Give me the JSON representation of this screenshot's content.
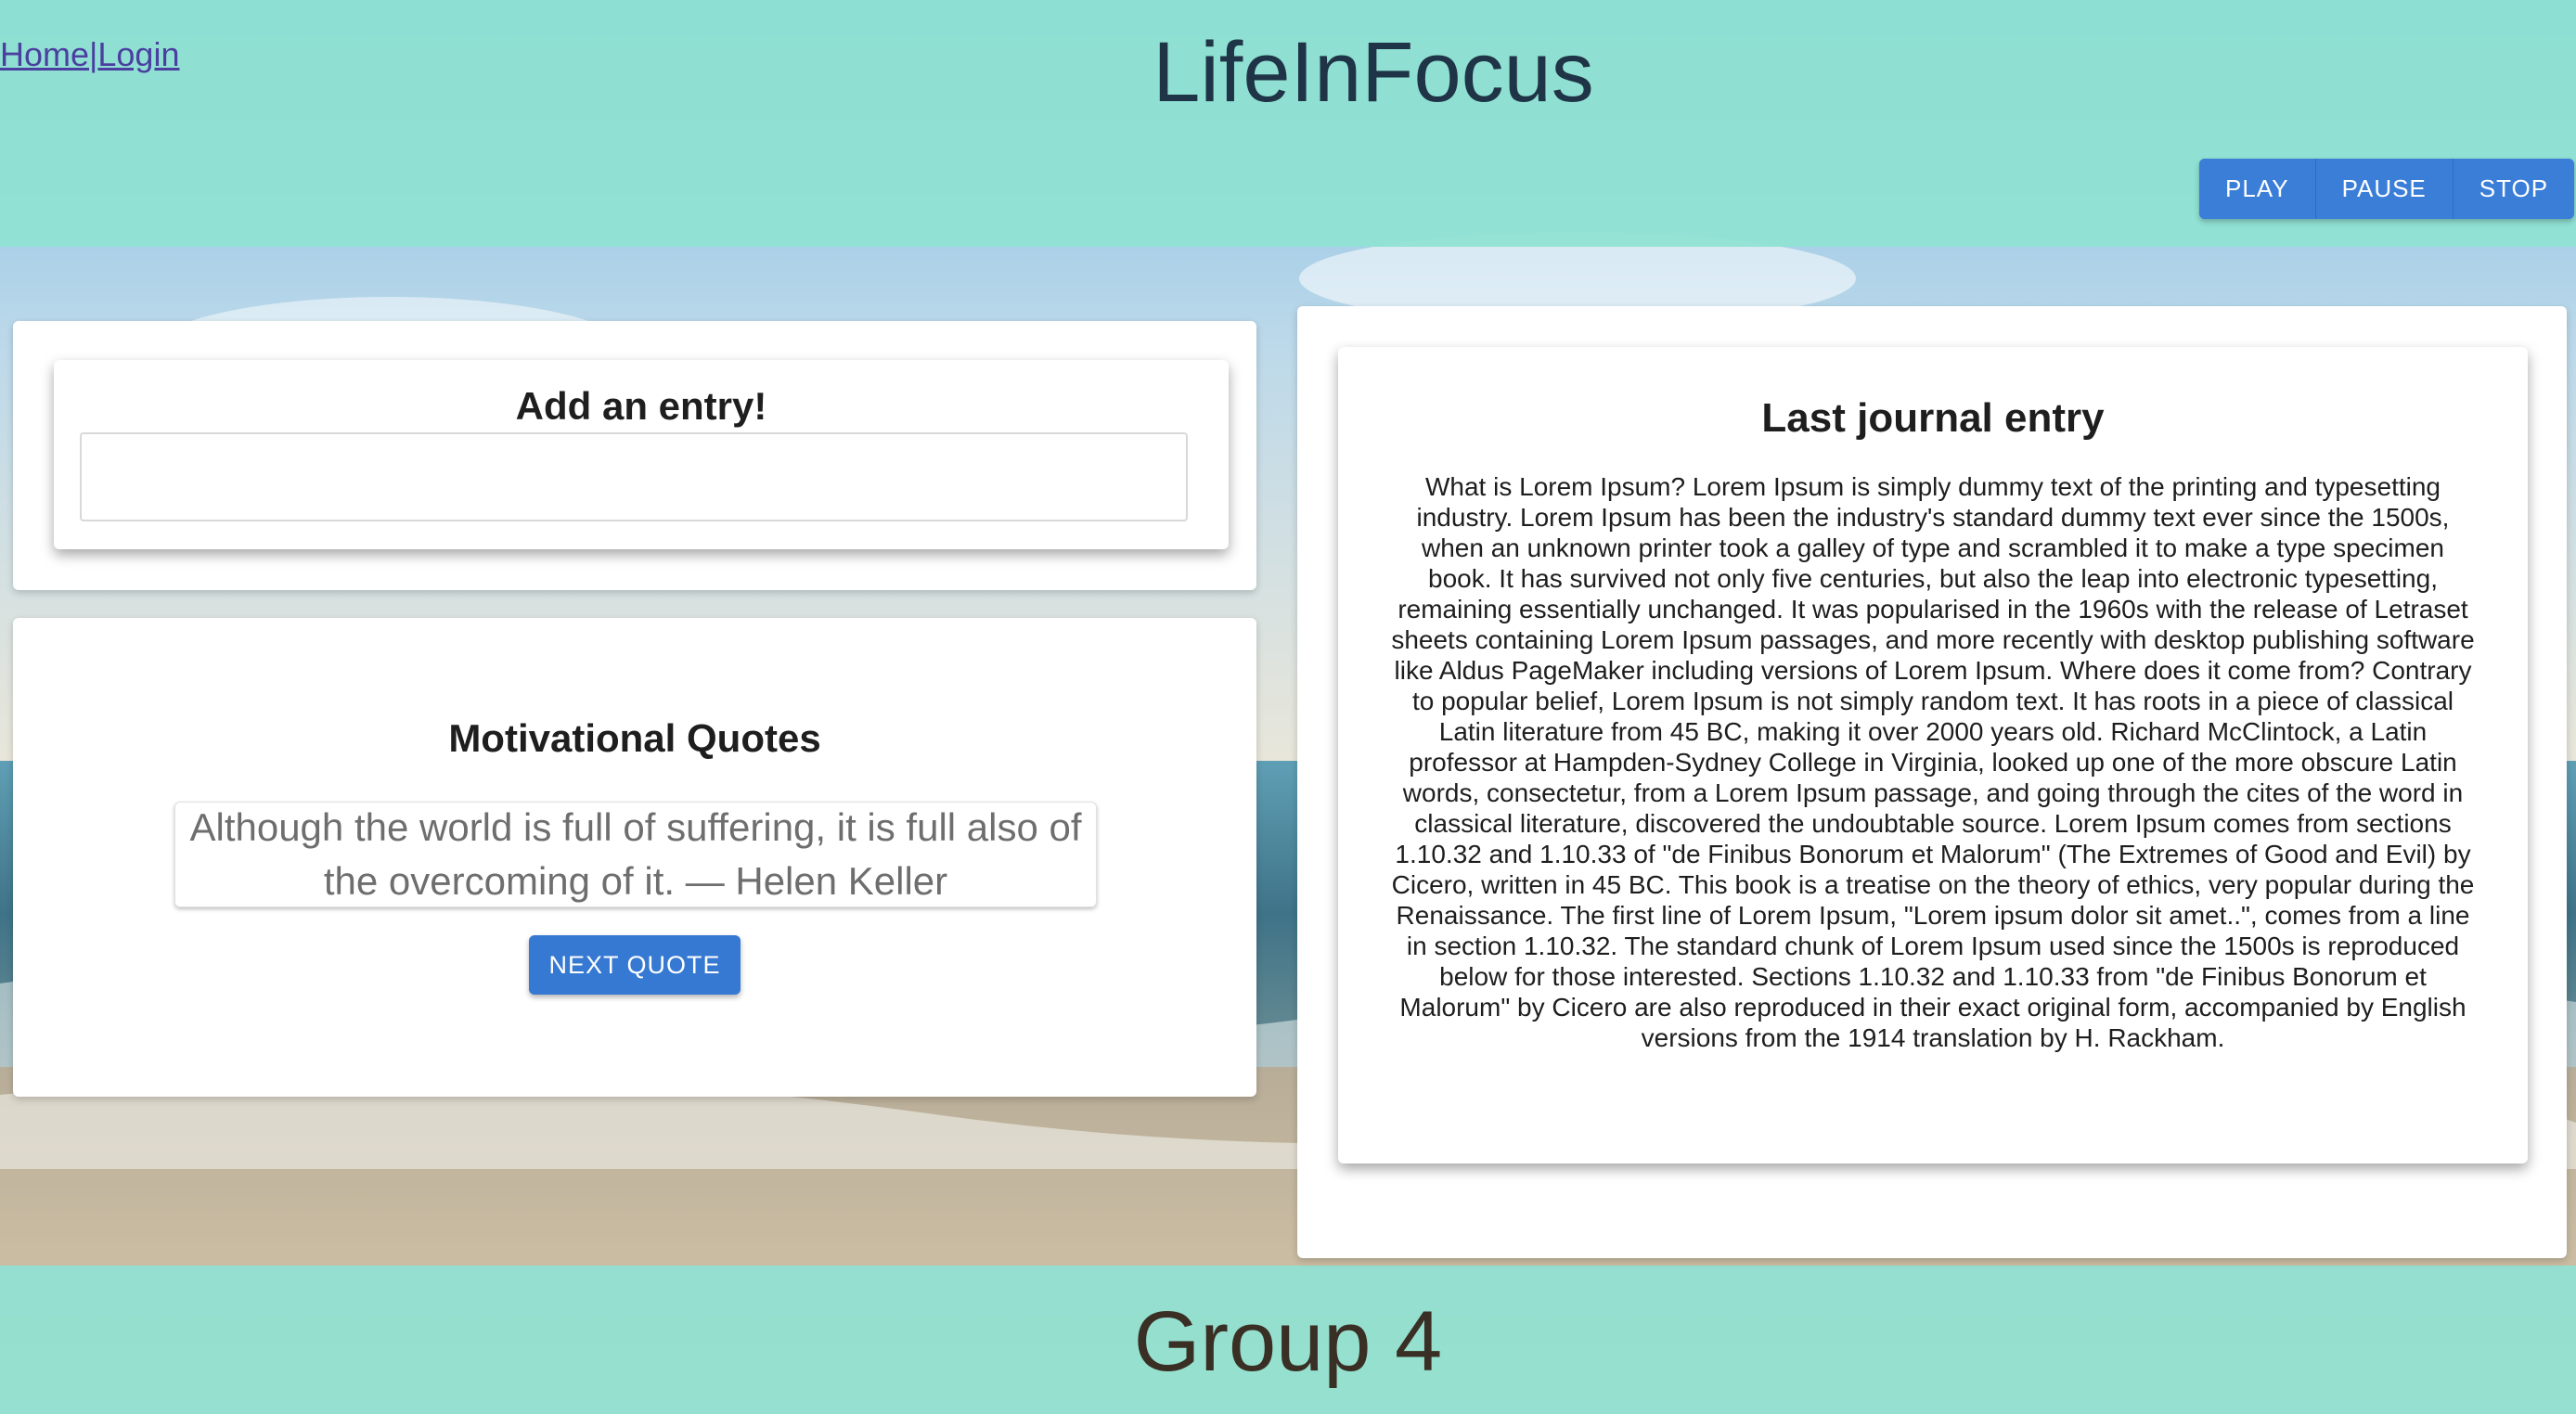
{
  "header": {
    "nav": {
      "home": "Home",
      "separator": "|",
      "login": "Login"
    },
    "title": "LifeInFocus",
    "player": {
      "play": "PLAY",
      "pause": "PAUSE",
      "stop": "STOP"
    }
  },
  "entry": {
    "title": "Add an entry!",
    "input_value": "",
    "placeholder": ""
  },
  "quotes": {
    "title": "Motivational Quotes",
    "quote": "Although the world is full of suffering, it is full also of the overcoming of it. — Helen Keller",
    "next_label": "NEXT QUOTE"
  },
  "journal": {
    "title": "Last journal entry",
    "text": "What is Lorem Ipsum? Lorem Ipsum is simply dummy text of the printing and typesetting industry. Lorem Ipsum has been the industry's standard dummy text ever since the 1500s, when an unknown printer took a galley of type and scrambled it to make a type specimen book. It has survived not only five centuries, but also the leap into electronic typesetting, remaining essentially unchanged. It was popularised in the 1960s with the release of Letraset sheets containing Lorem Ipsum passages, and more recently with desktop publishing software like Aldus PageMaker including versions of Lorem Ipsum. Where does it come from? Contrary to popular belief, Lorem Ipsum is not simply random text. It has roots in a piece of classical Latin literature from 45 BC, making it over 2000 years old. Richard McClintock, a Latin professor at Hampden-Sydney College in Virginia, looked up one of the more obscure Latin words, consectetur, from a Lorem Ipsum passage, and going through the cites of the word in classical literature, discovered the undoubtable source. Lorem Ipsum comes from sections 1.10.32 and 1.10.33 of \"de Finibus Bonorum et Malorum\" (The Extremes of Good and Evil) by Cicero, written in 45 BC. This book is a treatise on the theory of ethics, very popular during the Renaissance. The first line of Lorem Ipsum, \"Lorem ipsum dolor sit amet..\", comes from a line in section 1.10.32. The standard chunk of Lorem Ipsum used since the 1500s is reproduced below for those interested. Sections 1.10.32 and 1.10.33 from \"de Finibus Bonorum et Malorum\" by Cicero are also reproduced in their exact original form, accompanied by English versions from the 1914 translation by H. Rackham."
  },
  "footer": {
    "text": "Group 4"
  },
  "colors": {
    "header_bg": "#8fe2d2",
    "button_blue": "#3b7ed8",
    "title_text": "#1f3446",
    "nav_link": "#4b3fa0"
  }
}
